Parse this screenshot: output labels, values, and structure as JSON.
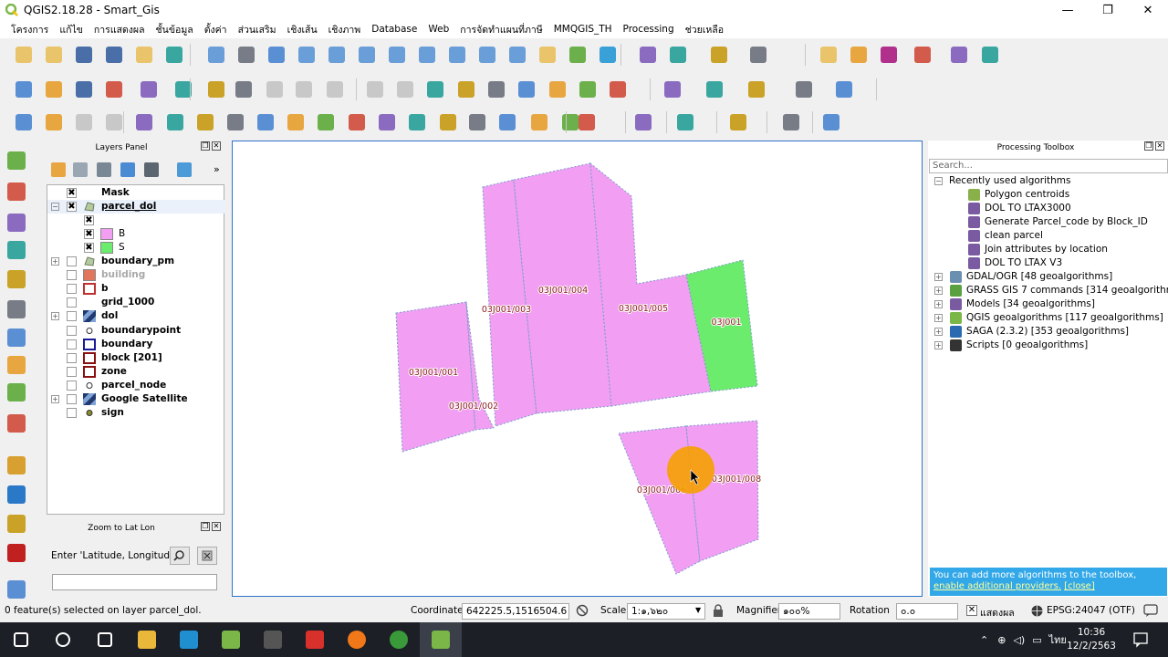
{
  "window": {
    "title": "QGIS2.18.28 - Smart_Gis",
    "minimize": "—",
    "restore": "❐",
    "close": "✕"
  },
  "menu": [
    "โครงการ",
    "แก้ไข",
    "การแสดงผล",
    "ชั้นข้อมูล",
    "ตั้งค่า",
    "ส่วนเสริม",
    "เชิงเส้น",
    "เชิงภาพ",
    "Database",
    "Web",
    "การจัดทำแผนที่ภาษี",
    "MMQGIS_TH",
    "Processing",
    "ช่วยเหลือ"
  ],
  "icons": {
    "row1": [
      "new-project-icon",
      "open-project-icon",
      "save-project-icon",
      "save-as-icon",
      "new-print-composer-icon",
      "composer-manager-icon",
      "touch-zoom-icon",
      "pan-icon",
      "pan-to-selection-icon",
      "zoom-in-icon",
      "zoom-out-icon",
      "zoom-native-icon",
      "zoom-full-icon",
      "zoom-to-selection-icon",
      "zoom-to-layer-icon",
      "zoom-last-icon",
      "zoom-next-icon",
      "new-bookmark-icon",
      "show-bookmarks-icon",
      "refresh-icon",
      "identify-icon",
      "map-tips-icon",
      "select-feature-icon",
      "deselect-icon",
      "open-attribute-table-icon",
      "field-calculator-icon",
      "statistics-sigma-icon",
      "measure-icon",
      "annotation-icon",
      "text-annotation-icon"
    ],
    "row2": [
      "current-edits-icon",
      "toggle-editing-icon",
      "save-edits-icon",
      "add-feature-icon",
      "add-part-icon",
      "move-feature-icon",
      "node-tool-icon",
      "delete-selected-icon",
      "cut-features-icon",
      "copy-features-icon",
      "paste-features-icon",
      "undo-icon",
      "redo-icon",
      "digitize-icon",
      "rotate-icon",
      "simplify-icon",
      "add-ring-icon",
      "add-part-poly-icon",
      "fill-ring-icon",
      "grid-icon",
      "circle-icon",
      "rectangle-icon",
      "ellipse-icon",
      "regular-shape-icon",
      "offset-curve-icon"
    ],
    "row3": [
      "snapping-icon",
      "magnet-icon",
      "undo-gray-icon",
      "redo-gray-icon",
      "reshape-icon",
      "split-icon",
      "merge-icon",
      "merge-attributes-icon",
      "rotate-point-icon",
      "delete-part-icon",
      "delete-ring-icon",
      "split-parts-icon",
      "offset-icon",
      "reshape-features-icon",
      "scissors-icon",
      "tools-icon",
      "vertex-icon",
      "align-icon",
      "rotate-feature-icon",
      "python-icon",
      "help-icon",
      "label-icon",
      "plugin-icon",
      "layer-icon",
      "stamp-icon"
    ],
    "left": [
      "add-vector-layer-icon",
      "add-raster-layer-icon",
      "add-delimited-text-icon",
      "add-spatialite-icon",
      "add-wms-icon",
      "add-wfs-icon",
      "add-wcs-icon",
      "add-oracle-icon",
      "add-virtual-layer-icon",
      "add-csv-icon",
      "georeferencer-icon",
      "home-icon",
      "new-shapefile-icon",
      "gps-icon",
      "more-tools-icon"
    ]
  },
  "layers_panel": {
    "title": "Layers Panel",
    "layers": [
      {
        "name": "Mask",
        "checked": true,
        "type": "group",
        "expandable": false
      },
      {
        "name": "parcel_dol",
        "checked": true,
        "type": "polygon",
        "expandable": true,
        "expanded": true,
        "underline": true
      },
      {
        "name": "",
        "checked": true,
        "type": "class-blank",
        "indent": true
      },
      {
        "name": "B",
        "checked": true,
        "type": "class-pink",
        "indent": true,
        "color": "#f19ef3"
      },
      {
        "name": "S",
        "checked": true,
        "type": "class-green",
        "indent": true,
        "color": "#6cec6c"
      },
      {
        "name": "boundary_pm",
        "checked": false,
        "type": "polygon",
        "expandable": true
      },
      {
        "name": "building",
        "checked": false,
        "type": "fill-salmon",
        "grayed": true,
        "color": "#e2765c"
      },
      {
        "name": "b",
        "checked": false,
        "type": "outline-red",
        "color": "#c03030"
      },
      {
        "name": "grid_1000",
        "checked": false,
        "type": "blank"
      },
      {
        "name": "dol",
        "checked": false,
        "type": "raster",
        "expandable": true
      },
      {
        "name": "boundarypoint",
        "checked": false,
        "type": "point"
      },
      {
        "name": "boundary",
        "checked": false,
        "type": "outline-blue",
        "color": "#1a1a9a"
      },
      {
        "name": "block [201]",
        "checked": false,
        "type": "outline-darkred",
        "color": "#8a1010"
      },
      {
        "name": "zone",
        "checked": false,
        "type": "outline-darkred",
        "color": "#8a1010"
      },
      {
        "name": "parcel_node",
        "checked": false,
        "type": "point"
      },
      {
        "name": "Google Satellite",
        "checked": false,
        "type": "raster",
        "expandable": true
      },
      {
        "name": "sign",
        "checked": false,
        "type": "point-olive"
      }
    ]
  },
  "zoom_panel": {
    "title": "Zoom to Lat Lon",
    "label": "Enter 'Latitude, Longitude'",
    "input_value": ""
  },
  "map": {
    "parcels": [
      {
        "label": "03J001/001",
        "color": "#f19ef3"
      },
      {
        "label": "03J001/002",
        "color": "#f19ef3"
      },
      {
        "label": "03J001/003",
        "color": "#f19ef3"
      },
      {
        "label": "03J001/004",
        "color": "#f19ef3"
      },
      {
        "label": "03J001/005",
        "color": "#f19ef3"
      },
      {
        "label": "03J001",
        "color": "#6cec6c"
      },
      {
        "label": "03J001/006",
        "color": "#f19ef3"
      },
      {
        "label": "03J001/008",
        "color": "#f19ef3"
      }
    ],
    "label_color": "#8b1a1a",
    "cursor_highlight": "#f5a000"
  },
  "processing": {
    "title": "Processing Toolbox",
    "search_placeholder": "Search...",
    "recent_title": "Recently used algorithms",
    "recent": [
      "Polygon centroids",
      "DOL TO LTAX3000",
      "Generate Parcel_code by Block_ID",
      "clean parcel",
      "Join attributes by location",
      "DOL TO LTAX V3"
    ],
    "providers": [
      "GDAL/OGR [48 geoalgorithms]",
      "GRASS GIS 7 commands [314 geoalgorithms]",
      "Models [34 geoalgorithms]",
      "QGIS geoalgorithms [117 geoalgorithms]",
      "SAGA (2.3.2) [353 geoalgorithms]",
      "Scripts [0 geoalgorithms]"
    ],
    "note_text": "You can add more algorithms to the toolbox,",
    "note_link": "enable additional providers.",
    "note_close": "[close]"
  },
  "status": {
    "selection": "0 feature(s) selected on layer parcel_dol.",
    "coordinate_label": "Coordinate",
    "coordinate_value": "642225.5,1516504.6",
    "scale_label": "Scale",
    "scale_value": "1:๑,๖๒๐",
    "magnifier_label": "Magnifier",
    "magnifier_value": "๑๐๐%",
    "rotation_label": "Rotation",
    "rotation_value": "๐.๐",
    "render_label": "แสดงผล",
    "crs": "EPSG:24047 (OTF)"
  },
  "taskbar": {
    "apps": [
      "start-icon",
      "search-icon",
      "task-view-icon",
      "file-explorer-icon",
      "qgis-browser-icon",
      "qgis-icon",
      "app-icon",
      "acrobat-icon",
      "firefox-icon",
      "chrome-icon",
      "qgis-active-icon"
    ],
    "lang": "ไทย",
    "time": "10:36",
    "date": "12/2/2563"
  }
}
